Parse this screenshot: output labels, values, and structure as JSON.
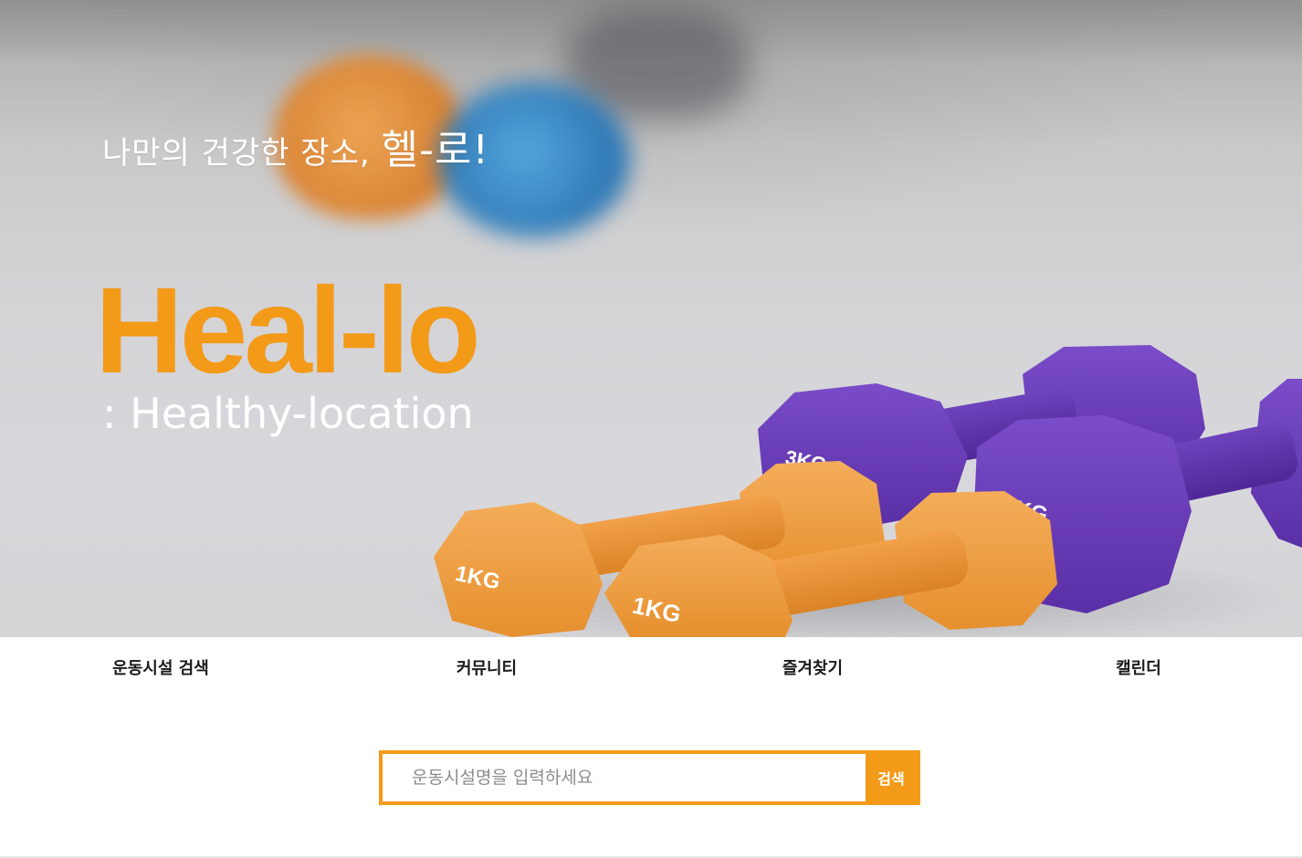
{
  "hero": {
    "tagline_prefix": "나만의 건강한 장소, ",
    "tagline_emphasis": "헬-로!",
    "logo_title": "Heal-lo",
    "logo_subtitle": ": Healthy-location",
    "dumbbell_labels": {
      "purple_back": "3KG",
      "purple_front": "3KG",
      "orange_back": "1KG",
      "orange_front": "1KG"
    }
  },
  "nav": {
    "items": [
      {
        "label": "운동시설 검색"
      },
      {
        "label": "커뮤니티"
      },
      {
        "label": "즐겨찾기"
      },
      {
        "label": "캘린더"
      }
    ]
  },
  "search": {
    "placeholder": "운동시설명을 입력하세요",
    "value": "",
    "button_label": "검색"
  },
  "colors": {
    "accent": "#f39a18",
    "nav_text": "#1a1a1a",
    "hero_text": "#ffffff"
  }
}
